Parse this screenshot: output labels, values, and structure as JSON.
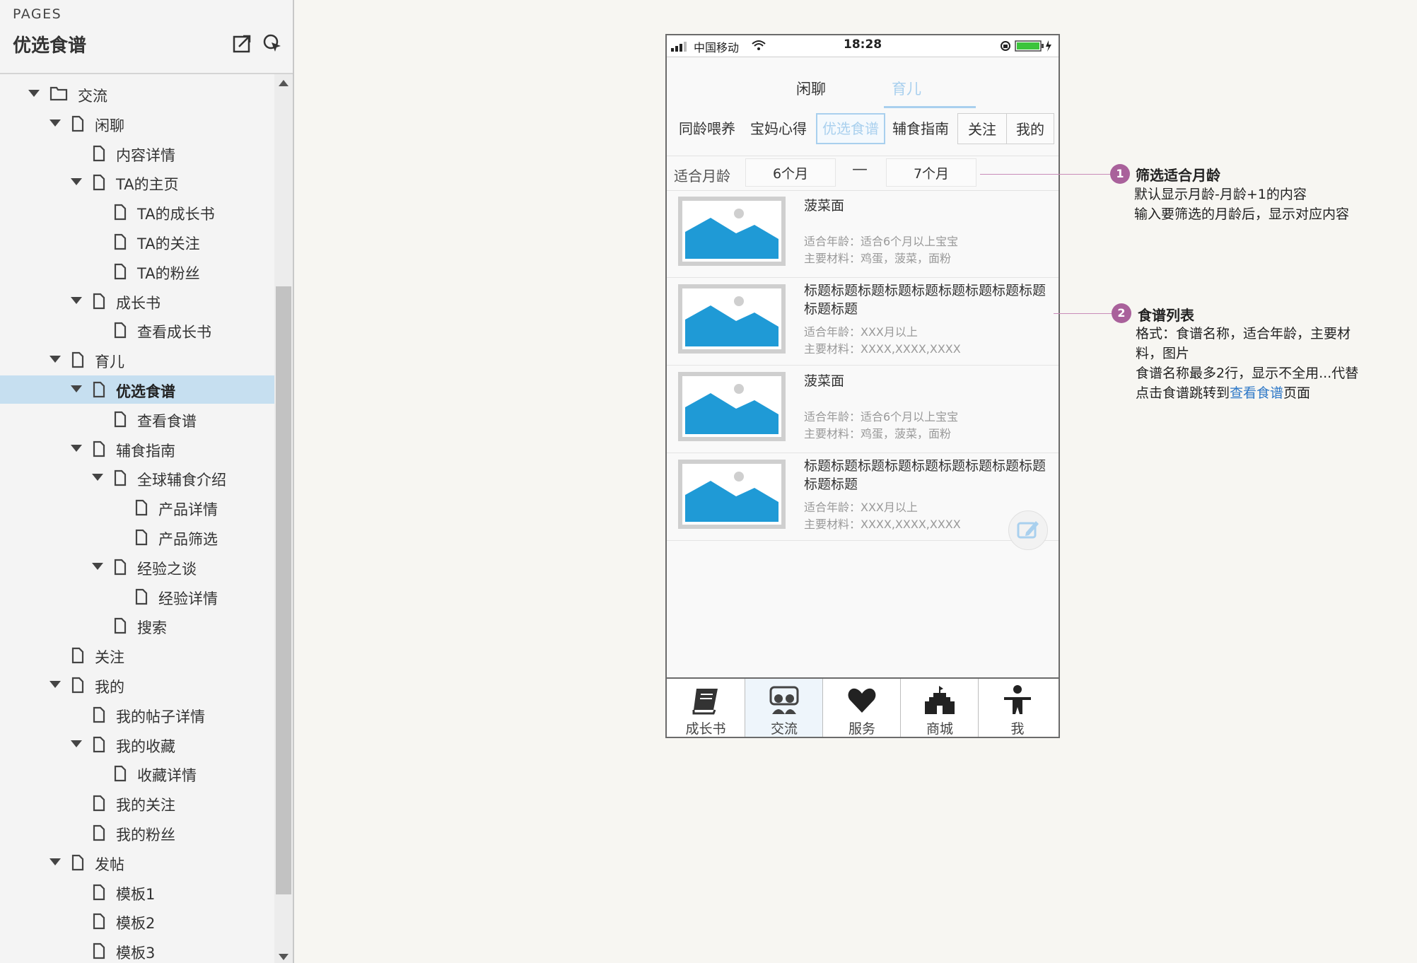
{
  "sidebar": {
    "pages_label": "PAGES",
    "title": "优选食谱",
    "tree": [
      {
        "label": "交流",
        "type": "folder",
        "level": 0,
        "expanded": true
      },
      {
        "label": "闲聊",
        "type": "page",
        "level": 1,
        "expanded": true
      },
      {
        "label": "内容详情",
        "type": "page",
        "level": 2
      },
      {
        "label": "TA的主页",
        "type": "page",
        "level": 2,
        "expanded": true
      },
      {
        "label": "TA的成长书",
        "type": "page",
        "level": 3
      },
      {
        "label": "TA的关注",
        "type": "page",
        "level": 3
      },
      {
        "label": "TA的粉丝",
        "type": "page",
        "level": 3
      },
      {
        "label": "成长书",
        "type": "page",
        "level": 2,
        "expanded": true
      },
      {
        "label": "查看成长书",
        "type": "page",
        "level": 3
      },
      {
        "label": "育儿",
        "type": "page",
        "level": 1,
        "expanded": true
      },
      {
        "label": "优选食谱",
        "type": "page",
        "level": 2,
        "expanded": true,
        "selected": true
      },
      {
        "label": "查看食谱",
        "type": "page",
        "level": 3
      },
      {
        "label": "辅食指南",
        "type": "page",
        "level": 2,
        "expanded": true
      },
      {
        "label": "全球辅食介绍",
        "type": "page",
        "level": 3,
        "expanded": true
      },
      {
        "label": "产品详情",
        "type": "page",
        "level": 4
      },
      {
        "label": "产品筛选",
        "type": "page",
        "level": 4
      },
      {
        "label": "经验之谈",
        "type": "page",
        "level": 3,
        "expanded": true
      },
      {
        "label": "经验详情",
        "type": "page",
        "level": 4
      },
      {
        "label": "搜索",
        "type": "page",
        "level": 3
      },
      {
        "label": "关注",
        "type": "page",
        "level": 1
      },
      {
        "label": "我的",
        "type": "page",
        "level": 1,
        "expanded": true
      },
      {
        "label": "我的帖子详情",
        "type": "page",
        "level": 2
      },
      {
        "label": "我的收藏",
        "type": "page",
        "level": 2,
        "expanded": true
      },
      {
        "label": "收藏详情",
        "type": "page",
        "level": 3
      },
      {
        "label": "我的关注",
        "type": "page",
        "level": 2
      },
      {
        "label": "我的粉丝",
        "type": "page",
        "level": 2
      },
      {
        "label": "发帖",
        "type": "page",
        "level": 1,
        "expanded": true
      },
      {
        "label": "模板1",
        "type": "page",
        "level": 2
      },
      {
        "label": "模板2",
        "type": "page",
        "level": 2
      },
      {
        "label": "模板3",
        "type": "page",
        "level": 2
      }
    ]
  },
  "phone": {
    "status": {
      "carrier": "中国移动",
      "time": "18:28"
    },
    "top_tabs": [
      {
        "label": "闲聊",
        "active": false
      },
      {
        "label": "育儿",
        "active": true
      }
    ],
    "sub_tabs": [
      {
        "label": "同龄喂养",
        "active": false
      },
      {
        "label": "宝妈心得",
        "active": false
      },
      {
        "label": "优选食谱",
        "active": true
      },
      {
        "label": "辅食指南",
        "active": false
      },
      {
        "label": "关注",
        "active": false
      },
      {
        "label": "我的",
        "active": false
      }
    ],
    "filter": {
      "label": "适合月龄",
      "from": "6个月",
      "separator": "—",
      "to": "7个月"
    },
    "recipes": [
      {
        "name": "菠菜面",
        "age": "适合年龄：适合6个月以上宝宝",
        "materials": "主要材料：鸡蛋，菠菜，面粉"
      },
      {
        "name": "标题标题标题标题标题标题标题标题标题标题标题",
        "age": "适合年龄：XXX月以上",
        "materials": "主要材料：XXXX,XXXX,XXXX"
      },
      {
        "name": "菠菜面",
        "age": "适合年龄：适合6个月以上宝宝",
        "materials": "主要材料：鸡蛋，菠菜，面粉"
      },
      {
        "name": "标题标题标题标题标题标题标题标题标题标题标题",
        "age": "适合年龄：XXX月以上",
        "materials": "主要材料：XXXX,XXXX,XXXX"
      }
    ],
    "bottom_tabs": [
      {
        "label": "成长书",
        "icon": "book-icon",
        "active": false
      },
      {
        "label": "交流",
        "icon": "chat-icon",
        "active": true
      },
      {
        "label": "服务",
        "icon": "heart-icon",
        "active": false
      },
      {
        "label": "商城",
        "icon": "castle-icon",
        "active": false
      },
      {
        "label": "我",
        "icon": "person-icon",
        "active": false
      }
    ]
  },
  "annotations": [
    {
      "num": "1",
      "title": "筛选适合月龄",
      "lines": [
        "默认显示月龄-月龄+1的内容",
        "输入要筛选的月龄后，显示对应内容"
      ]
    },
    {
      "num": "2",
      "title": "食谱列表",
      "lines": [
        "格式：食谱名称，适合年龄，主要材",
        "料，图片",
        "食谱名称最多2行，显示不全用...代替"
      ],
      "last": {
        "prefix": "点击食谱跳转到",
        "link": "查看食谱",
        "suffix": "页面"
      }
    }
  ],
  "colors": {
    "accent": "#a9d0ee",
    "badge": "#a9619b",
    "image_blue": "#1f9ad6",
    "link": "#2e78c7"
  }
}
